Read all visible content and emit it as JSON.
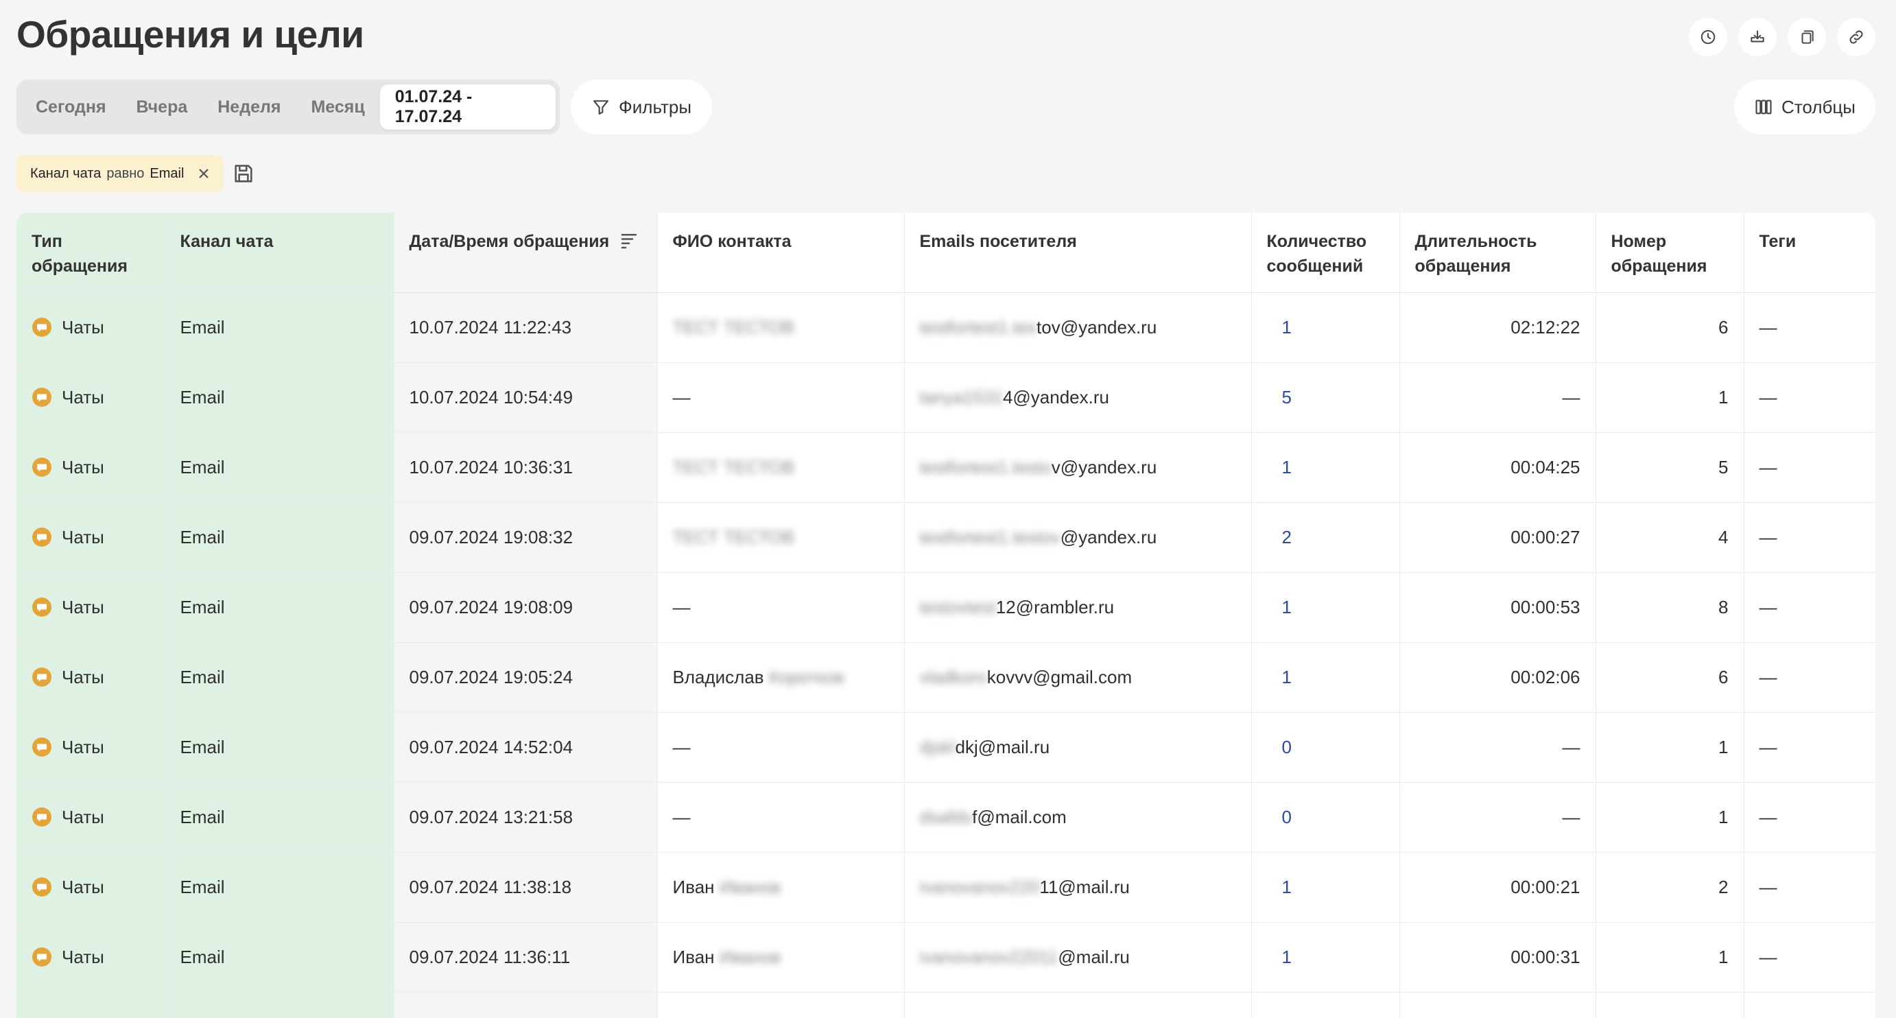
{
  "page": {
    "title": "Обращения и цели"
  },
  "top_actions": [
    "history-icon",
    "download-icon",
    "copy-icon",
    "link-icon"
  ],
  "periods": {
    "tabs": [
      "Сегодня",
      "Вчера",
      "Неделя",
      "Месяц",
      "01.07.24 - 17.07.24"
    ],
    "active_index": 4
  },
  "filters_button": {
    "label": "Фильтры"
  },
  "columns_button": {
    "label": "Столбцы"
  },
  "filter_chip": {
    "field": "Канал чата",
    "operator": "равно",
    "value": "Email"
  },
  "colors": {
    "accent_green": "#dff1e3",
    "chip_yellow": "#fbf1cf",
    "chat_icon": "#e3a43a",
    "count_blue": "#2b4aa0"
  },
  "table": {
    "headers": {
      "type": "Тип обращения",
      "channel": "Канал чата",
      "datetime": "Дата/Время обращения",
      "name": "ФИО контакта",
      "email": "Emails посетителя",
      "messages": "Количество сообщений",
      "duration": "Длительность обращения",
      "number": "Номер обращения",
      "tags": "Теги"
    },
    "rows": [
      {
        "type": "Чаты",
        "channel": "Email",
        "datetime": "10.07.2024 11:22:43",
        "name_visible": "",
        "name_blurred": "ТЕСТ ТЕСТОВ",
        "email_blurred": "testfortest1.tes",
        "email_visible": "tov@yandex.ru",
        "messages": "1",
        "duration": "02:12:22",
        "number": "6",
        "tags": "—"
      },
      {
        "type": "Чаты",
        "channel": "Email",
        "datetime": "10.07.2024 10:54:49",
        "name_visible": "—",
        "name_blurred": "",
        "email_blurred": "tanya1531",
        "email_visible": "4@yandex.ru",
        "messages": "5",
        "duration": "—",
        "number": "1",
        "tags": "—"
      },
      {
        "type": "Чаты",
        "channel": "Email",
        "datetime": "10.07.2024 10:36:31",
        "name_visible": "",
        "name_blurred": "ТЕСТ ТЕСТОВ",
        "email_blurred": "testfortest1.testo",
        "email_visible": "v@yandex.ru",
        "messages": "1",
        "duration": "00:04:25",
        "number": "5",
        "tags": "—"
      },
      {
        "type": "Чаты",
        "channel": "Email",
        "datetime": "09.07.2024 19:08:32",
        "name_visible": "",
        "name_blurred": "ТЕСТ ТЕСТОВ",
        "email_blurred": "testfortest1.testov",
        "email_visible": "@yandex.ru",
        "messages": "2",
        "duration": "00:00:27",
        "number": "4",
        "tags": "—"
      },
      {
        "type": "Чаты",
        "channel": "Email",
        "datetime": "09.07.2024 19:08:09",
        "name_visible": "—",
        "name_blurred": "",
        "email_blurred": "testovtest",
        "email_visible": "12@rambler.ru",
        "messages": "1",
        "duration": "00:00:53",
        "number": "8",
        "tags": "—"
      },
      {
        "type": "Чаты",
        "channel": "Email",
        "datetime": "09.07.2024 19:05:24",
        "name_visible": "Владислав",
        "name_blurred": "Коротков",
        "email_blurred": "vladkoro",
        "email_visible": "kovvv@gmail.com",
        "messages": "1",
        "duration": "00:02:06",
        "number": "6",
        "tags": "—"
      },
      {
        "type": "Чаты",
        "channel": "Email",
        "datetime": "09.07.2024 14:52:04",
        "name_visible": "—",
        "name_blurred": "",
        "email_blurred": "djskl",
        "email_visible": "dkj@mail.ru",
        "messages": "0",
        "duration": "—",
        "number": "1",
        "tags": "—"
      },
      {
        "type": "Чаты",
        "channel": "Email",
        "datetime": "09.07.2024 13:21:58",
        "name_visible": "—",
        "name_blurred": "",
        "email_blurred": "dsafds",
        "email_visible": "f@mail.com",
        "messages": "0",
        "duration": "—",
        "number": "1",
        "tags": "—"
      },
      {
        "type": "Чаты",
        "channel": "Email",
        "datetime": "09.07.2024 11:38:18",
        "name_visible": "Иван",
        "name_blurred": "Иванов",
        "email_blurred": "ivanovanov220",
        "email_visible": "11@mail.ru",
        "messages": "1",
        "duration": "00:00:21",
        "number": "2",
        "tags": "—"
      },
      {
        "type": "Чаты",
        "channel": "Email",
        "datetime": "09.07.2024 11:36:11",
        "name_visible": "Иван",
        "name_blurred": "Иванов",
        "email_blurred": "ivanovanov22011",
        "email_visible": "@mail.ru",
        "messages": "1",
        "duration": "00:00:31",
        "number": "1",
        "tags": "—"
      }
    ]
  }
}
